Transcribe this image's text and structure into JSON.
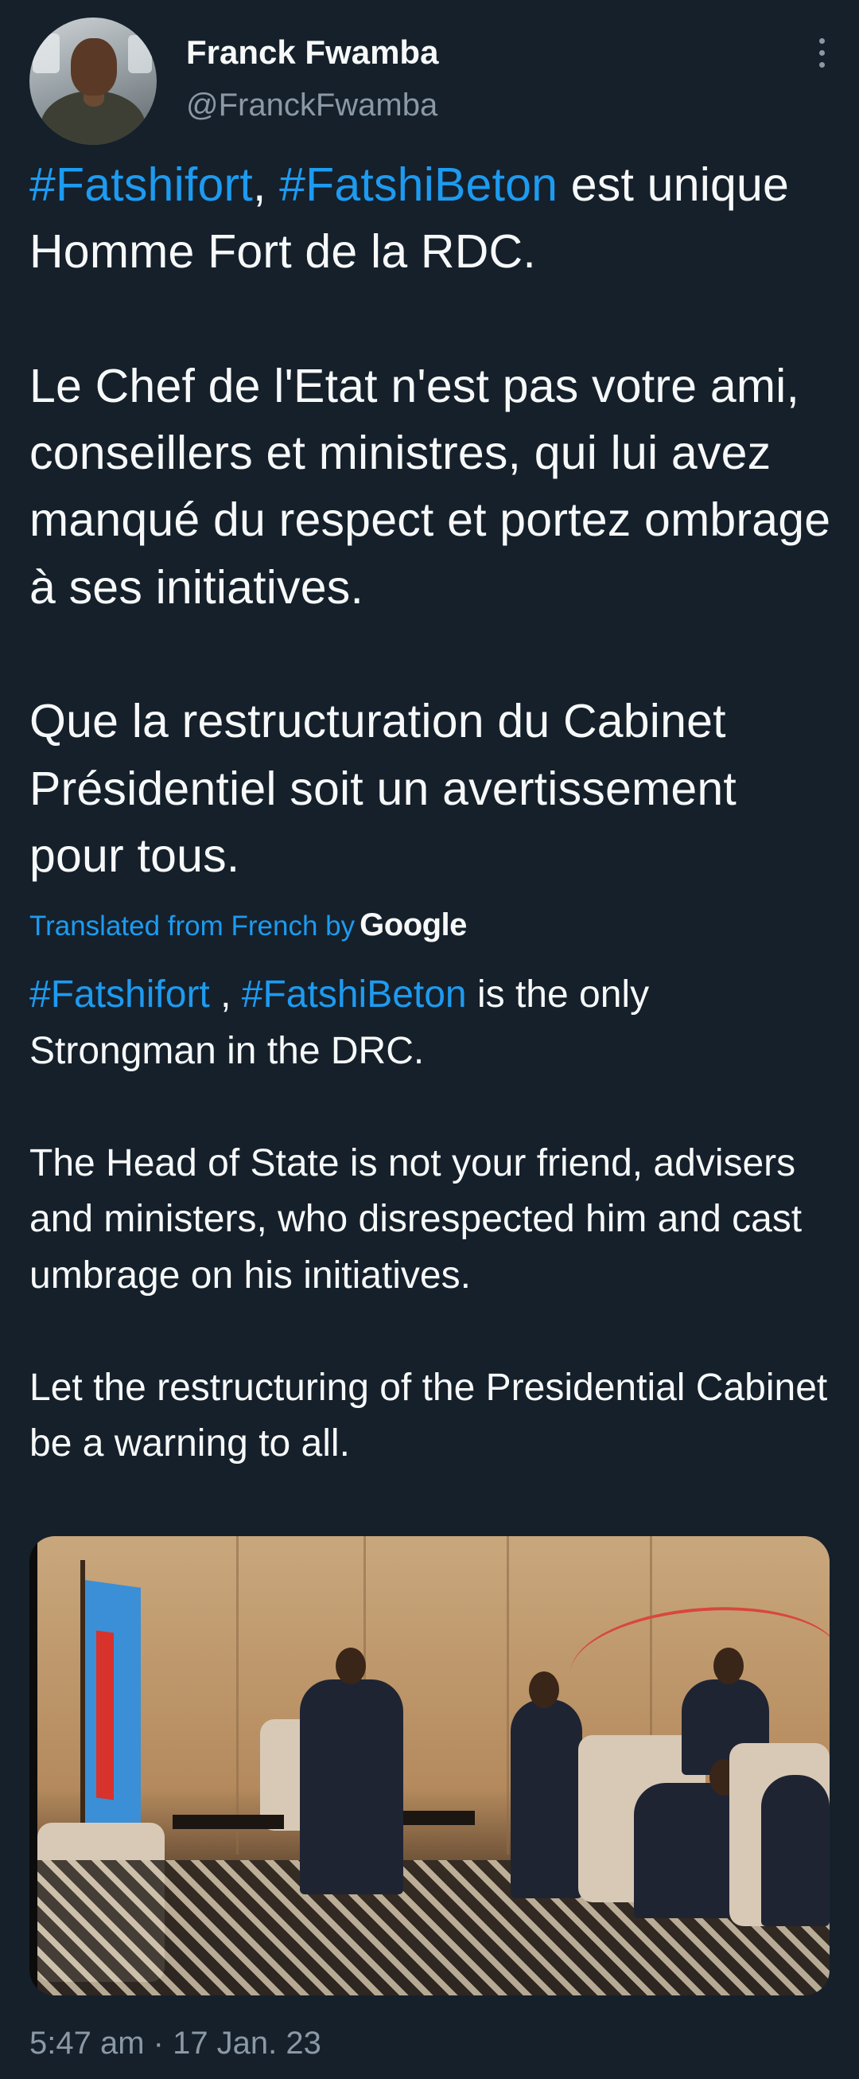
{
  "author": {
    "name": "Franck Fwamba",
    "handle": "@FranckFwamba"
  },
  "tweet": {
    "original": {
      "hashtag1": "#Fatshifort",
      "sep": ", ",
      "hashtag2": "#FatshiBeton",
      "line1_rest": " est unique Homme Fort de la RDC.",
      "para2": "Le Chef de l'Etat n'est pas votre ami, conseillers et ministres, qui lui avez manqué du respect et portez ombrage à ses initiatives.",
      "para3": "Que la restructuration du Cabinet Présidentiel soit un avertissement pour tous."
    },
    "translation_label": "Translated from French by",
    "translation_provider": "Google",
    "translated": {
      "hashtag1": "#Fatshifort",
      "sep": " , ",
      "hashtag2": "#FatshiBeton",
      "line1_rest": " is the only Strongman in the DRC.",
      "para2": "The Head of State is not your friend, advisers and ministers, who disrespected him and cast umbrage on his initiatives.",
      "para3": "Let the restructuring of the Presidential Cabinet be a warning to all."
    },
    "timestamp": "5:47 am · 17 Jan. 23"
  },
  "icons": {
    "more": "more-vertical-icon"
  },
  "colors": {
    "background": "#15202b",
    "text": "#f7f9f9",
    "secondary": "#8b98a5",
    "accent": "#1d9bf0"
  }
}
